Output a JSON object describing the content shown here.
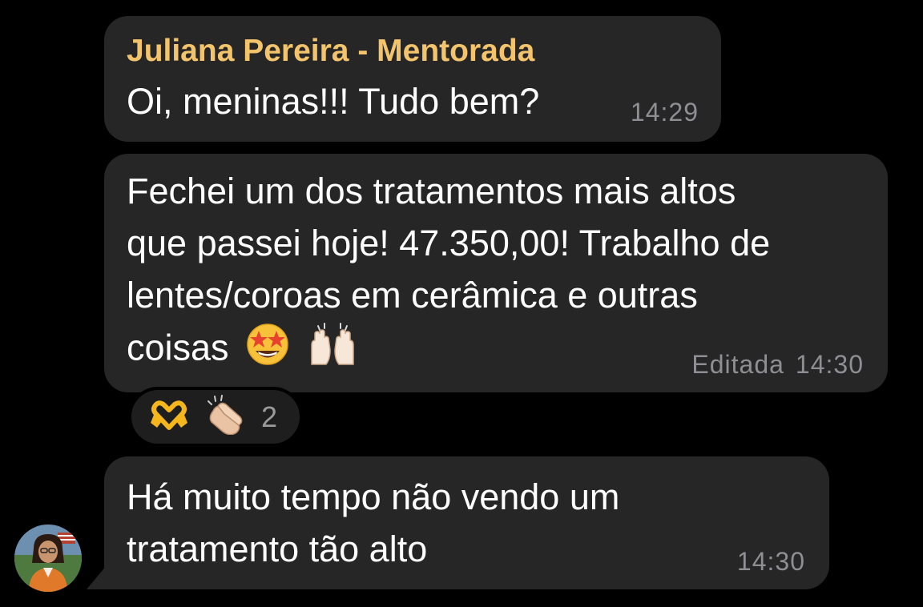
{
  "chat": {
    "messages": [
      {
        "sender": "Juliana Pereira - Mentorada",
        "text": "Oi, meninas!!! Tudo bem?",
        "time": "14:29"
      },
      {
        "lines": [
          "Fechei um dos tratamentos mais altos",
          "que passei hoje! 47.350,00! Trabalho de",
          "lentes/coroas em cerâmica e outras",
          "coisas"
        ],
        "emojis": [
          "star-struck-face-icon",
          "raising-hands-icon"
        ],
        "edited_label": "Editada",
        "time": "14:30",
        "reactions": {
          "icons": [
            "heart-hands-icon",
            "clapping-hands-icon"
          ],
          "count": "2"
        }
      },
      {
        "lines": [
          "Há muito tempo não vendo um",
          "tratamento tão alto"
        ],
        "time": "14:30"
      }
    ]
  },
  "colors": {
    "background": "#000000",
    "bubble": "#262626",
    "sender_name": "#f3c46b",
    "timestamp": "#8e8e93"
  }
}
